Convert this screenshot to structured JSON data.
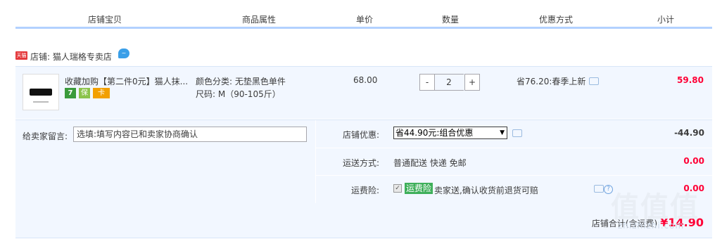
{
  "header": {
    "cols": [
      "店铺宝贝",
      "商品属性",
      "单价",
      "数量",
      "优惠方式",
      "小计"
    ]
  },
  "shop": {
    "badge": "天猫",
    "label": "店铺: 猫人瑞格专卖店",
    "chat_icon": "wangwang-icon"
  },
  "item": {
    "title": "收藏加购【第二件0元】猫人抹...",
    "attr_color": "颜色分类: 无垫黑色单件",
    "attr_size": "尺码: M（90-105斤）",
    "price": "68.00",
    "qty_minus": "-",
    "qty_value": "2",
    "qty_plus": "+",
    "promo": "省76.20:春季上新",
    "subtotal": "59.80",
    "badges": [
      "7",
      "保",
      "卡"
    ]
  },
  "message": {
    "label": "给卖家留言:",
    "placeholder": "选填:填写内容已和卖家协商确认"
  },
  "summary": {
    "discount_label": "店铺优惠:",
    "discount_select": "省44.90元:组合优惠",
    "discount_amount": "-44.90",
    "shipping_label": "运送方式:",
    "shipping_value": "普通配送 快递 免邮",
    "shipping_amount": "0.00",
    "insurance_label": "运费险:",
    "insurance_badge": "运费险",
    "insurance_text": "卖家送,确认收货前退货可赔",
    "insurance_amount": "0.00",
    "total_label": "店铺合计(含运费)",
    "total_value": "¥14.90"
  },
  "watermark": {
    "logo": "值值值",
    "site": "zhizhizhi.com"
  },
  "colors": {
    "accent_red": "#ff0036",
    "header_line": "#b2d1ff",
    "row_bg": "#f2f7ff",
    "insurance_green": "#3eaf5a"
  }
}
